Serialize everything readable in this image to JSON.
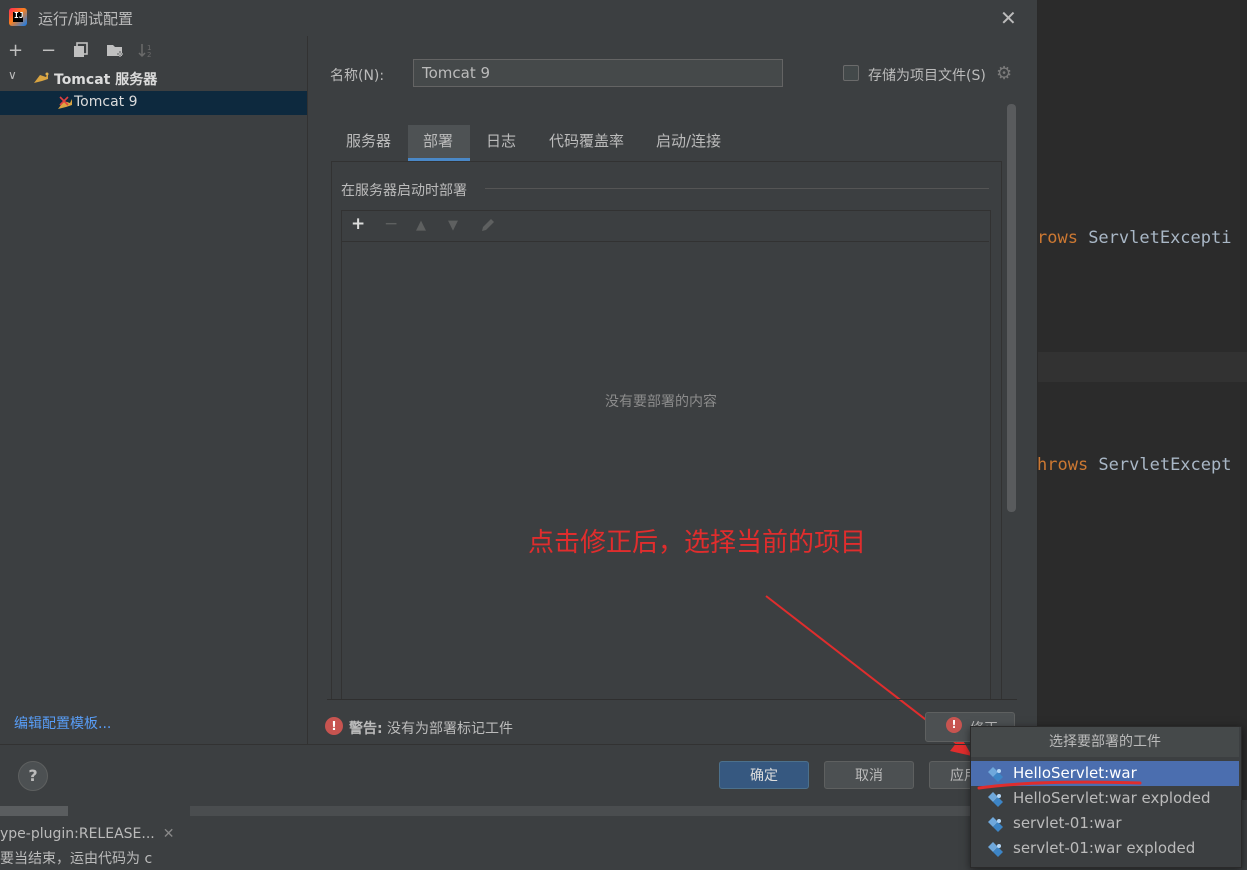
{
  "window": {
    "title": "运行/调试配置",
    "close_symbol": "✕"
  },
  "left_panel": {
    "toolbar": {
      "add": "+",
      "remove": "−",
      "copy_icon": "copy-icon",
      "folder_icon": "new-folder-icon",
      "sort_icon": "sort-icon"
    },
    "tree": {
      "root_label": "Tomcat 服务器",
      "child_label": "Tomcat 9"
    },
    "edit_templates_link": "编辑配置模板..."
  },
  "form": {
    "name_label": "名称(N):",
    "name_value": "Tomcat 9",
    "store_as_project_file_label": "存储为项目文件(S)",
    "store_checked": false
  },
  "tabs": [
    {
      "label": "服务器",
      "active": false
    },
    {
      "label": "部署",
      "active": true
    },
    {
      "label": "日志",
      "active": false
    },
    {
      "label": "代码覆盖率",
      "active": false
    },
    {
      "label": "启动/连接",
      "active": false
    }
  ],
  "deployment": {
    "section_title": "在服务器启动时部署",
    "empty_text": "没有要部署的内容"
  },
  "annotation": {
    "text": "点击修正后，选择当前的项目",
    "color": "#e02d2d"
  },
  "warning": {
    "prefix": "警告:",
    "message": " 没有为部署标记工件",
    "fix_label": "修正"
  },
  "footer": {
    "help": "?",
    "ok": "确定",
    "cancel": "取消",
    "apply": "应用"
  },
  "popup": {
    "title": "选择要部署的工件",
    "items": [
      {
        "label": "HelloServlet:war",
        "selected": true
      },
      {
        "label": "HelloServlet:war exploded",
        "selected": false
      },
      {
        "label": "servlet-01:war",
        "selected": false
      },
      {
        "label": "servlet-01:war exploded",
        "selected": false
      }
    ]
  },
  "background_editor": {
    "line1_kw": "rows",
    "line1_rest": " ServletExcepti",
    "line2_kw": "hrows",
    "line2_rest": " ServletExcept"
  },
  "bottom": {
    "plugin_tab": "ype-plugin:RELEASE...",
    "status_text": "要当结束，运由代码为 c"
  },
  "colors": {
    "accent": "#4a88c7",
    "selection": "#4b6eaf",
    "link": "#589df6",
    "error": "#c75450"
  }
}
